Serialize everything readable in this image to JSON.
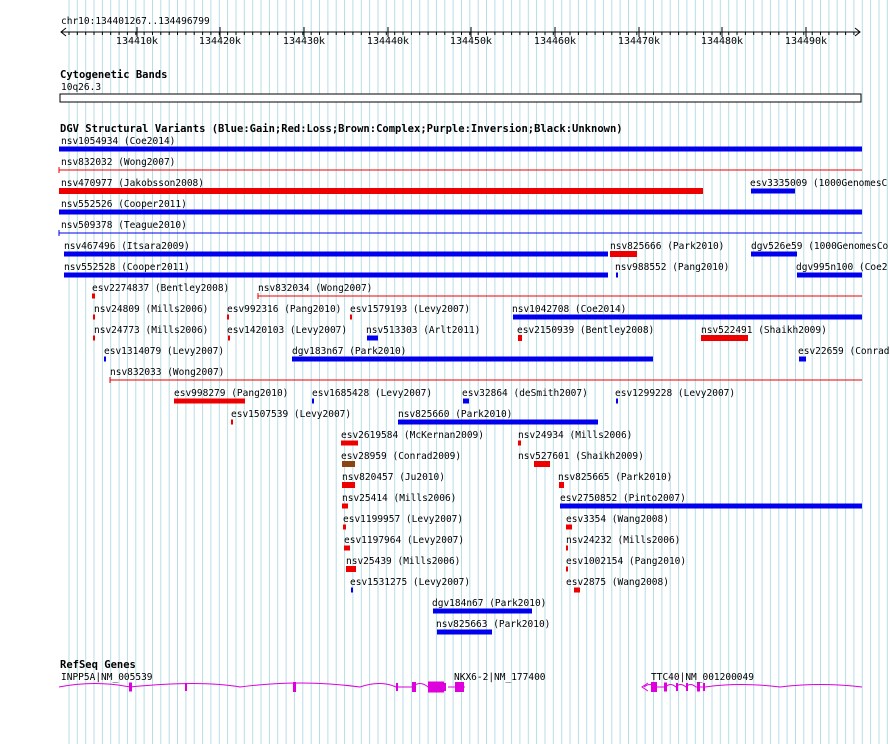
{
  "position": {
    "label": "chr10:134401267..134496799",
    "ticks": [
      "134410k",
      "134420k",
      "134430k",
      "134440k",
      "134450k",
      "134460k",
      "134470k",
      "134480k",
      "134490k"
    ]
  },
  "cytoband": {
    "title": "Cytogenetic Bands",
    "band": "10q26.3"
  },
  "dgv": {
    "title": "DGV Structural Variants (Blue:Gain;Red:Loss;Brown:Complex;Purple:Inversion;Black:Unknown)",
    "colors": {
      "gain": "#0000ee",
      "loss": "#ee0000",
      "complex": "#8b4513"
    },
    "variants": [
      {
        "label": "nsv1054934 (Coe2014)",
        "type": "gain"
      },
      {
        "label": "nsv832032 (Wong2007)",
        "type": "loss"
      },
      {
        "label": "nsv470977 (Jakobsson2008)",
        "type": "loss"
      },
      {
        "label": "esv3335009 (1000GenomesC",
        "type": "gain"
      },
      {
        "label": "nsv552526 (Cooper2011)",
        "type": "gain"
      },
      {
        "label": "nsv509378 (Teague2010)",
        "type": "gain"
      },
      {
        "label": "nsv467496 (Itsara2009)",
        "type": "gain"
      },
      {
        "label": "nsv825666 (Park2010)",
        "type": "loss"
      },
      {
        "label": "dgv526e59 (1000GenomesCo",
        "type": "gain"
      },
      {
        "label": "nsv552528 (Cooper2011)",
        "type": "gain"
      },
      {
        "label": "nsv988552 (Pang2010)",
        "type": "gain"
      },
      {
        "label": "dgv995n100 (Coe2",
        "type": "gain"
      },
      {
        "label": "esv2274837 (Bentley2008)",
        "type": "loss"
      },
      {
        "label": "nsv832034 (Wong2007)",
        "type": "loss"
      },
      {
        "label": "nsv24809 (Mills2006)",
        "type": "loss"
      },
      {
        "label": "esv992316 (Pang2010)",
        "type": "loss"
      },
      {
        "label": "esv1579193 (Levy2007)",
        "type": "loss"
      },
      {
        "label": "nsv1042708 (Coe2014)",
        "type": "gain"
      },
      {
        "label": "nsv24773 (Mills2006)",
        "type": "loss"
      },
      {
        "label": "esv1420103 (Levy2007)",
        "type": "loss"
      },
      {
        "label": "nsv513303 (Arlt2011)",
        "type": "gain"
      },
      {
        "label": "esv2150939 (Bentley2008)",
        "type": "loss"
      },
      {
        "label": "nsv522491 (Shaikh2009)",
        "type": "loss"
      },
      {
        "label": "esv1314079 (Levy2007)",
        "type": "gain"
      },
      {
        "label": "dgv183n67 (Park2010)",
        "type": "gain"
      },
      {
        "label": "esv22659 (Conrad",
        "type": "gain"
      },
      {
        "label": "nsv832033 (Wong2007)",
        "type": "loss"
      },
      {
        "label": "esv998279 (Pang2010)",
        "type": "loss"
      },
      {
        "label": "esv1685428 (Levy2007)",
        "type": "gain"
      },
      {
        "label": "esv32864 (deSmith2007)",
        "type": "gain"
      },
      {
        "label": "esv1299228 (Levy2007)",
        "type": "gain"
      },
      {
        "label": "esv1507539 (Levy2007)",
        "type": "loss"
      },
      {
        "label": "nsv825660 (Park2010)",
        "type": "gain"
      },
      {
        "label": "esv2619584 (McKernan2009)",
        "type": "loss"
      },
      {
        "label": "nsv24934 (Mills2006)",
        "type": "loss"
      },
      {
        "label": "esv28959 (Conrad2009)",
        "type": "complex"
      },
      {
        "label": "nsv527601 (Shaikh2009)",
        "type": "loss"
      },
      {
        "label": "nsv820457 (Ju2010)",
        "type": "loss"
      },
      {
        "label": "nsv825665 (Park2010)",
        "type": "loss"
      },
      {
        "label": "nsv25414 (Mills2006)",
        "type": "loss"
      },
      {
        "label": "esv2750852 (Pinto2007)",
        "type": "gain"
      },
      {
        "label": "esv1199957 (Levy2007)",
        "type": "loss"
      },
      {
        "label": "esv3354 (Wang2008)",
        "type": "loss"
      },
      {
        "label": "esv1197964 (Levy2007)",
        "type": "loss"
      },
      {
        "label": "nsv24232 (Mills2006)",
        "type": "loss"
      },
      {
        "label": "nsv25439 (Mills2006)",
        "type": "loss"
      },
      {
        "label": "esv1002154 (Pang2010)",
        "type": "loss"
      },
      {
        "label": "esv1531275 (Levy2007)",
        "type": "gain"
      },
      {
        "label": "esv2875 (Wang2008)",
        "type": "loss"
      },
      {
        "label": "dgv184n67 (Park2010)",
        "type": "gain"
      },
      {
        "label": "nsv825663 (Park2010)",
        "type": "gain"
      }
    ]
  },
  "refseq": {
    "title": "RefSeq Genes",
    "color": "#dd00dd",
    "genes": [
      {
        "label": "INPP5A|NM_005539"
      },
      {
        "label": "NKX6-2|NM_177400"
      },
      {
        "label": "TTC40|NM_001200049"
      }
    ]
  }
}
